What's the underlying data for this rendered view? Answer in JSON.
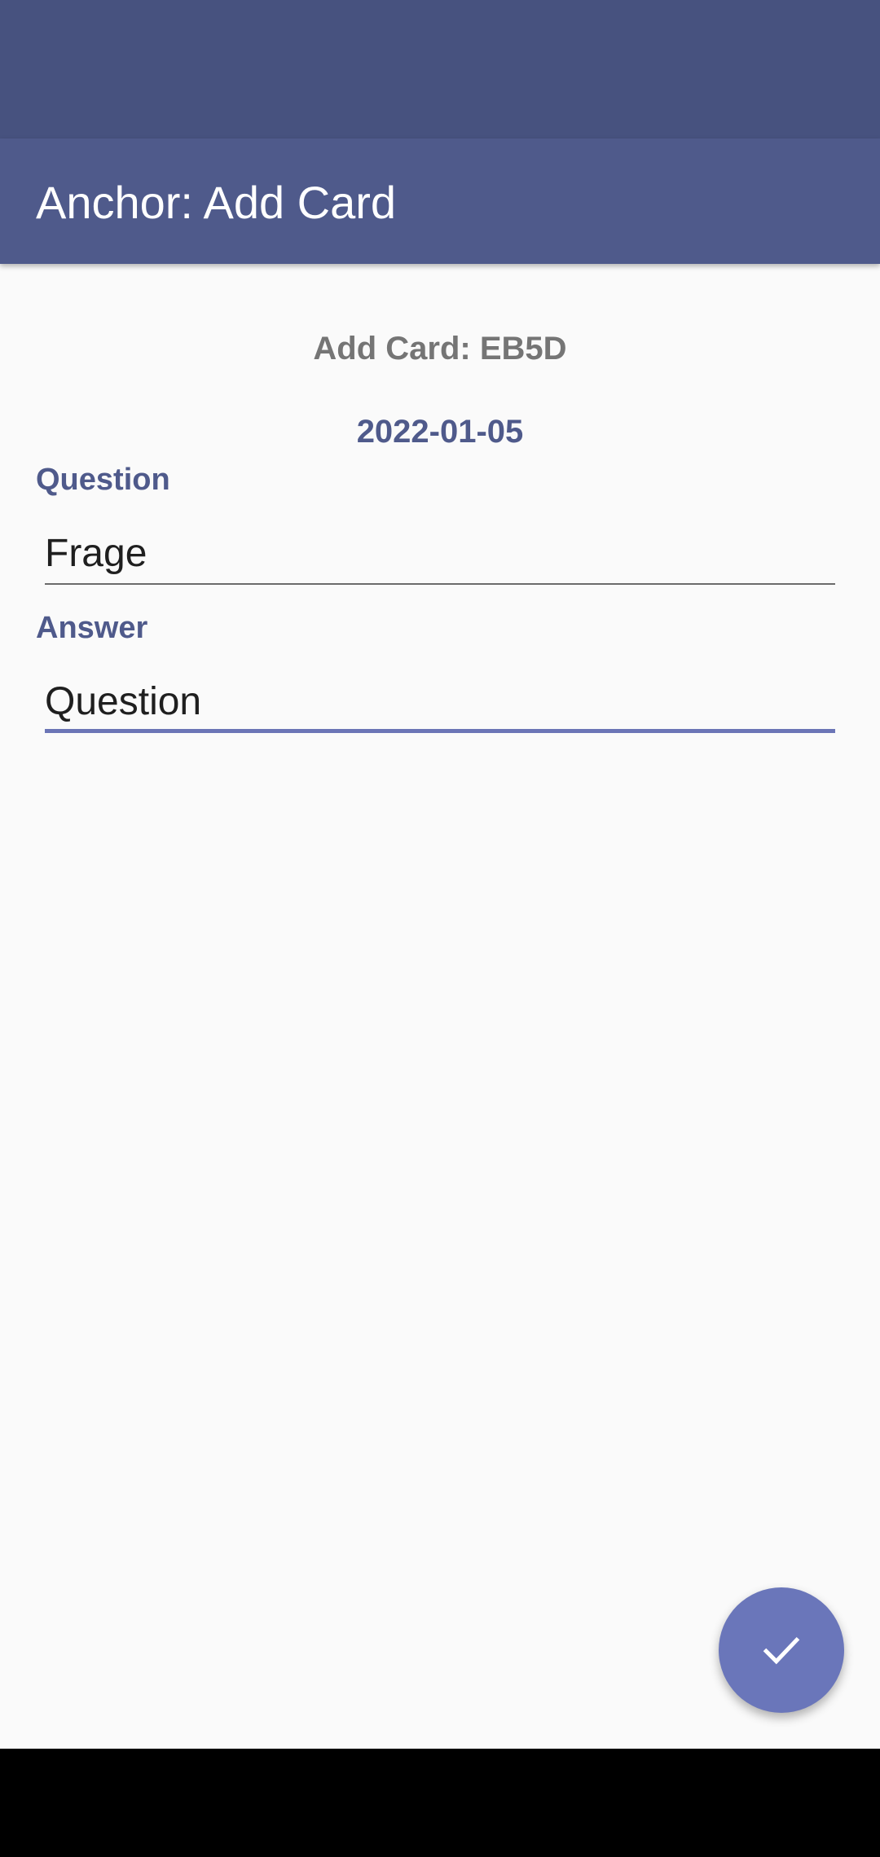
{
  "app_bar": {
    "title": "Anchor: Add Card"
  },
  "card": {
    "header": "Add Card: EB5D",
    "date": "2022-01-05"
  },
  "form": {
    "question": {
      "label": "Question",
      "value": "Frage"
    },
    "answer": {
      "label": "Answer",
      "value": "Question"
    }
  },
  "fab": {
    "icon": "check-icon"
  },
  "colors": {
    "status_bar": "#47527f",
    "primary": "#4f5a8b",
    "accent": "#6a76ba",
    "background": "#fafafa",
    "secondary_text": "#757575"
  }
}
